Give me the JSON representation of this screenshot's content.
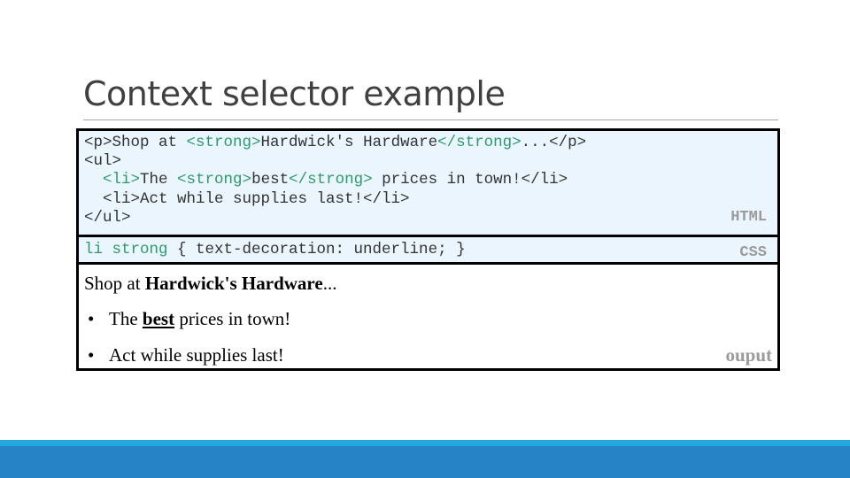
{
  "slide": {
    "title": "Context selector example"
  },
  "html_code": {
    "label": "HTML",
    "lines": [
      [
        {
          "t": "<p>Shop at ",
          "c": "n"
        },
        {
          "t": "<strong>",
          "c": "g"
        },
        {
          "t": "Hardwick's Hardware",
          "c": "n"
        },
        {
          "t": "</strong>",
          "c": "g"
        },
        {
          "t": "...</p>",
          "c": "n"
        }
      ],
      [
        {
          "t": "<ul>",
          "c": "n"
        }
      ],
      [
        {
          "t": "  ",
          "c": "n"
        },
        {
          "t": "<li>",
          "c": "g"
        },
        {
          "t": "The ",
          "c": "n"
        },
        {
          "t": "<strong>",
          "c": "g"
        },
        {
          "t": "best",
          "c": "n"
        },
        {
          "t": "</strong>",
          "c": "g"
        },
        {
          "t": " prices in town!</li>",
          "c": "n"
        }
      ],
      [
        {
          "t": "  <li>Act while supplies last!</li>",
          "c": "n"
        }
      ],
      [
        {
          "t": "</ul>",
          "c": "n"
        }
      ]
    ]
  },
  "css_code": {
    "label": "CSS",
    "selector": "li strong",
    "rule": " { text-decoration: underline; }"
  },
  "output": {
    "label": "ouput",
    "paragraph": {
      "prefix": "Shop at ",
      "strong": "Hardwick's Hardware",
      "suffix": "..."
    },
    "list_items": [
      {
        "bullet": "•",
        "prefix": "The ",
        "strong_underlined": "best",
        "suffix": " prices in town!"
      },
      {
        "bullet": "•",
        "text": "Act while supplies last!"
      }
    ]
  },
  "colors": {
    "tag_green": "#2e9a6a",
    "code_background": "#eaf5fd",
    "band_light": "#22a8de",
    "band_dark": "#2683c6"
  }
}
